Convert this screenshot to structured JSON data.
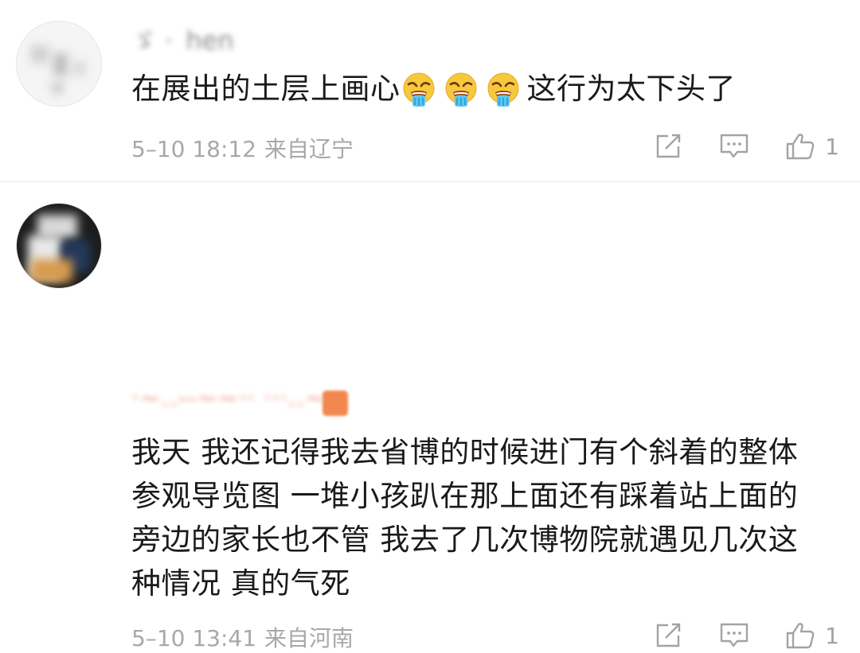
{
  "comments": [
    {
      "username": "ゞ · hen",
      "text_before": "在展出的土层上画心",
      "emoji_count": 3,
      "emoji_name": "weary-drooling-face",
      "text_after": "这行为太下头了",
      "date": "5–10 18:12",
      "source": "来自辽宁",
      "likes": "1"
    },
    {
      "username": "·~‥--~~·· ···‥~~",
      "text": "我天 我还记得我去省博的时候进门有个斜着的整体\n参观导览图 一堆小孩趴在那上面还有踩着站上面的\n旁边的家长也不管 我去了几次博物院就遇见几次这\n种情况 真的气死",
      "date": "5–10 13:41",
      "source": "来自河南",
      "likes": "1"
    }
  ],
  "icons": {
    "share": "share-icon",
    "reply": "comment-icon",
    "like": "thumbs-up-icon"
  },
  "colors": {
    "meta_gray": "#a8a8a8",
    "text": "#1a1a1a",
    "divider": "#e8e8e8"
  }
}
